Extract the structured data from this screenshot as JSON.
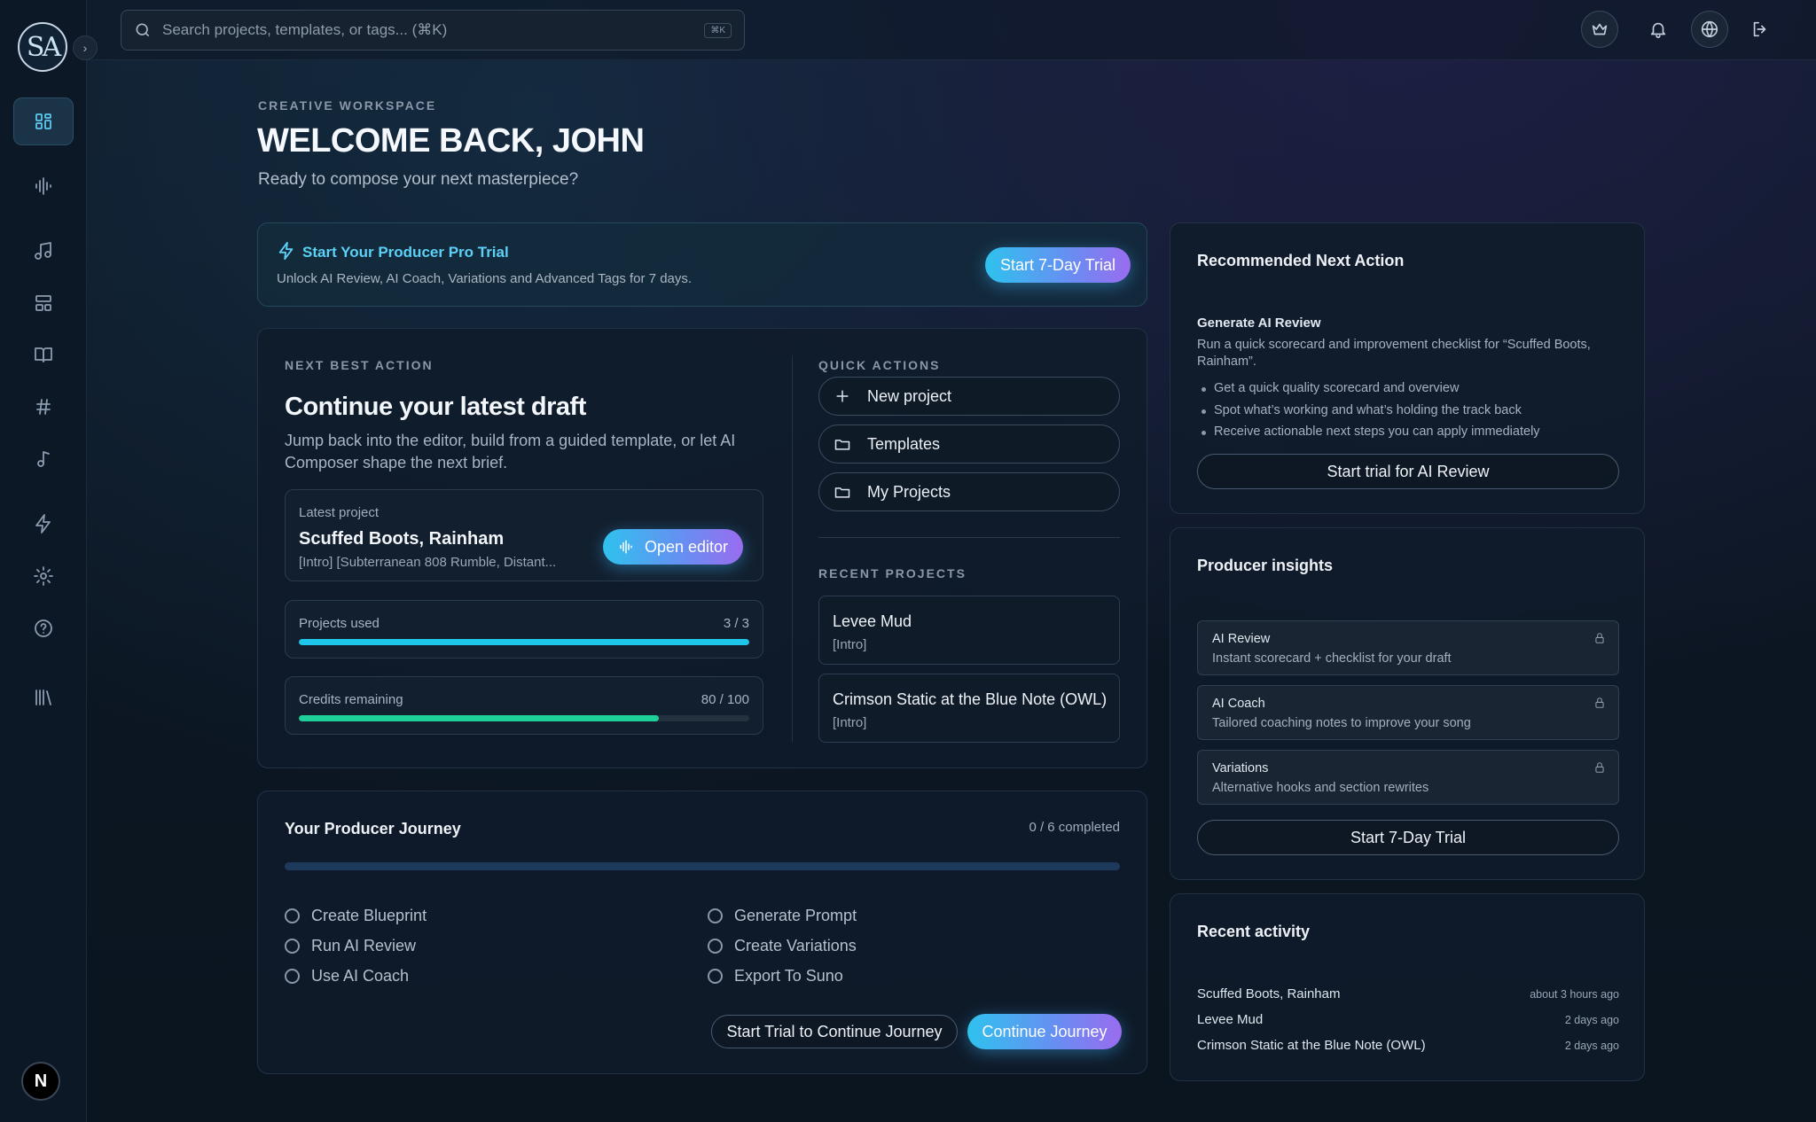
{
  "app": {
    "logo_text": "SA",
    "footer_badge": "N"
  },
  "search": {
    "placeholder": "Search projects, templates, or tags... (⌘K)",
    "kbd": "⌘K"
  },
  "sidebar": {
    "items": [
      {
        "name": "dashboard",
        "icon": "grid-icon",
        "active": true
      },
      {
        "name": "waveform",
        "icon": "waveform-icon"
      },
      {
        "name": "music",
        "icon": "music-note-icon"
      },
      {
        "name": "templates",
        "icon": "layout-icon"
      },
      {
        "name": "guide",
        "icon": "book-icon"
      },
      {
        "name": "tags",
        "icon": "hash-icon"
      },
      {
        "name": "note",
        "icon": "note-icon"
      },
      {
        "name": "power",
        "icon": "bolt-icon"
      },
      {
        "name": "settings",
        "icon": "gear-icon"
      },
      {
        "name": "help",
        "icon": "help-icon"
      },
      {
        "name": "library",
        "icon": "library-icon"
      }
    ]
  },
  "header": {
    "eyebrow": "CREATIVE WORKSPACE",
    "title": "WELCOME BACK, JOHN",
    "subtitle": "Ready to compose your next masterpiece?"
  },
  "trial_banner": {
    "title": "Start Your Producer Pro Trial",
    "subtitle": "Unlock AI Review, AI Coach, Variations and Advanced Tags for 7 days.",
    "button": "Start 7-Day Trial"
  },
  "next_best_action": {
    "eyebrow": "NEXT BEST ACTION",
    "title": "Continue your latest draft",
    "description": "Jump back into the editor, build from a guided template, or let AI Composer shape the next brief.",
    "latest_label": "Latest project",
    "latest_name": "Scuffed Boots, Rainham",
    "latest_tags": "[Intro] [Subterranean 808 Rumble, Distant...",
    "open_editor": "Open editor",
    "projects_used_label": "Projects used",
    "projects_used_value": "3 / 3",
    "projects_used_fraction": 1.0,
    "credits_label": "Credits remaining",
    "credits_value": "80 / 100",
    "credits_fraction": 0.8
  },
  "quick_actions": {
    "eyebrow": "QUICK ACTIONS",
    "new_project": "New project",
    "templates": "Templates",
    "my_projects": "My Projects"
  },
  "recent_projects": {
    "eyebrow": "RECENT PROJECTS",
    "items": [
      {
        "title": "Levee Mud",
        "tag": "[Intro]"
      },
      {
        "title": "Crimson Static at the Blue Note (OWL)",
        "tag": "[Intro]"
      }
    ]
  },
  "journey": {
    "title": "Your Producer Journey",
    "count": "0 / 6 completed",
    "steps": [
      "Create Blueprint",
      "Run AI Review",
      "Use AI Coach",
      "Generate Prompt",
      "Create Variations",
      "Export To Suno"
    ],
    "trial_button": "Start Trial to Continue Journey",
    "continue_button": "Continue Journey"
  },
  "recommended": {
    "title": "Recommended Next Action",
    "subheading": "Generate AI Review",
    "description": "Run a quick scorecard and improvement checklist for “Scuffed Boots, Rainham”.",
    "bullets": [
      "Get a quick quality scorecard and overview",
      "Spot what’s working and what’s holding the track back",
      "Receive actionable next steps you can apply immediately"
    ],
    "button": "Start trial for AI Review"
  },
  "insights": {
    "title": "Producer insights",
    "items": [
      {
        "title": "AI Review",
        "subtitle": "Instant scorecard + checklist for your draft"
      },
      {
        "title": "AI Coach",
        "subtitle": "Tailored coaching notes to improve your song"
      },
      {
        "title": "Variations",
        "subtitle": "Alternative hooks and section rewrites"
      }
    ],
    "button": "Start 7-Day Trial"
  },
  "activity": {
    "title": "Recent activity",
    "items": [
      {
        "name": "Scuffed Boots, Rainham",
        "when": "about 3 hours ago"
      },
      {
        "name": "Levee Mud",
        "when": "2 days ago"
      },
      {
        "name": "Crimson Static at the Blue Note (OWL)",
        "when": "2 days ago"
      }
    ]
  },
  "colors": {
    "accent": "#2fc2ee",
    "accent_purple": "#9a6cf0",
    "credits_bar": "#1fcf9a",
    "projects_bar": "#1ec7ea"
  }
}
